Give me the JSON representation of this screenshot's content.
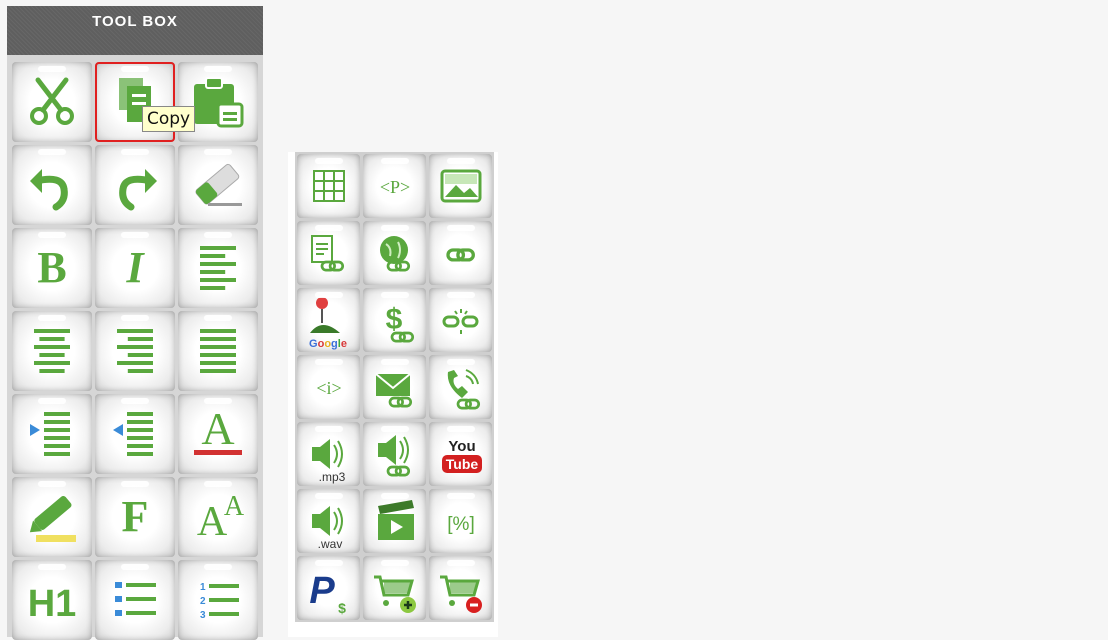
{
  "toolbox": {
    "title": "TOOL BOX",
    "tooltip": "Copy",
    "buttons": [
      {
        "icon": "scissors-icon",
        "name": "cut-button"
      },
      {
        "icon": "copy-icon",
        "name": "copy-button",
        "selected": true
      },
      {
        "icon": "paste-icon",
        "name": "paste-button"
      },
      {
        "icon": "undo-icon",
        "name": "undo-button"
      },
      {
        "icon": "redo-icon",
        "name": "redo-button"
      },
      {
        "icon": "eraser-icon",
        "name": "eraser-button"
      },
      {
        "icon": "bold-icon",
        "name": "bold-button",
        "label": "B"
      },
      {
        "icon": "italic-icon",
        "name": "italic-button",
        "label": "I"
      },
      {
        "icon": "align-left-icon",
        "name": "align-left-button"
      },
      {
        "icon": "align-center-icon",
        "name": "align-center-button"
      },
      {
        "icon": "align-right-icon",
        "name": "align-right-button"
      },
      {
        "icon": "align-justify-icon",
        "name": "align-justify-button"
      },
      {
        "icon": "indent-icon",
        "name": "indent-button"
      },
      {
        "icon": "outdent-icon",
        "name": "outdent-button"
      },
      {
        "icon": "font-color-icon",
        "name": "font-color-button",
        "label": "A"
      },
      {
        "icon": "highlighter-icon",
        "name": "highlight-button"
      },
      {
        "icon": "font-family-icon",
        "name": "font-family-button",
        "label": "F"
      },
      {
        "icon": "font-size-icon",
        "name": "font-size-button",
        "label": "AA"
      },
      {
        "icon": "heading-icon",
        "name": "heading-button",
        "label": "H1"
      },
      {
        "icon": "bulleted-list-icon",
        "name": "bulleted-list-button"
      },
      {
        "icon": "numbered-list-icon",
        "name": "numbered-list-button",
        "numbers": [
          "1",
          "2",
          "3"
        ]
      }
    ]
  },
  "insert_panel": {
    "buttons": [
      {
        "icon": "table-icon",
        "name": "insert-table-button"
      },
      {
        "icon": "paragraph-icon",
        "name": "insert-paragraph-button",
        "label": "<P>"
      },
      {
        "icon": "image-icon",
        "name": "insert-image-button"
      },
      {
        "icon": "document-link-icon",
        "name": "document-link-button"
      },
      {
        "icon": "web-link-icon",
        "name": "web-link-button"
      },
      {
        "icon": "link-icon",
        "name": "link-button"
      },
      {
        "icon": "google-map-icon",
        "name": "google-map-button",
        "label": "Google"
      },
      {
        "icon": "payment-link-icon",
        "name": "payment-link-button",
        "label": "$"
      },
      {
        "icon": "unlink-icon",
        "name": "unlink-button"
      },
      {
        "icon": "info-icon",
        "name": "insert-info-button",
        "label": "<i>"
      },
      {
        "icon": "email-link-icon",
        "name": "email-link-button"
      },
      {
        "icon": "phone-link-icon",
        "name": "phone-link-button"
      },
      {
        "icon": "mp3-audio-icon",
        "name": "mp3-audio-button",
        "label": ".mp3"
      },
      {
        "icon": "audio-link-icon",
        "name": "audio-link-button"
      },
      {
        "icon": "youtube-icon",
        "name": "youtube-button",
        "label_top": "You",
        "label_bottom": "Tube"
      },
      {
        "icon": "wav-audio-icon",
        "name": "wav-audio-button",
        "label": ".wav"
      },
      {
        "icon": "video-icon",
        "name": "video-button"
      },
      {
        "icon": "percent-icon",
        "name": "percent-button",
        "label": "[%]"
      },
      {
        "icon": "paypal-icon",
        "name": "paypal-button",
        "label": "P",
        "sub": "$"
      },
      {
        "icon": "add-to-cart-icon",
        "name": "add-to-cart-button"
      },
      {
        "icon": "remove-from-cart-icon",
        "name": "remove-from-cart-button"
      }
    ]
  },
  "colors": {
    "icon_green": "#5aa83e",
    "header_gray": "#5f5f5f",
    "selection_red": "#e02020",
    "tooltip_bg": "#ffffcc"
  }
}
